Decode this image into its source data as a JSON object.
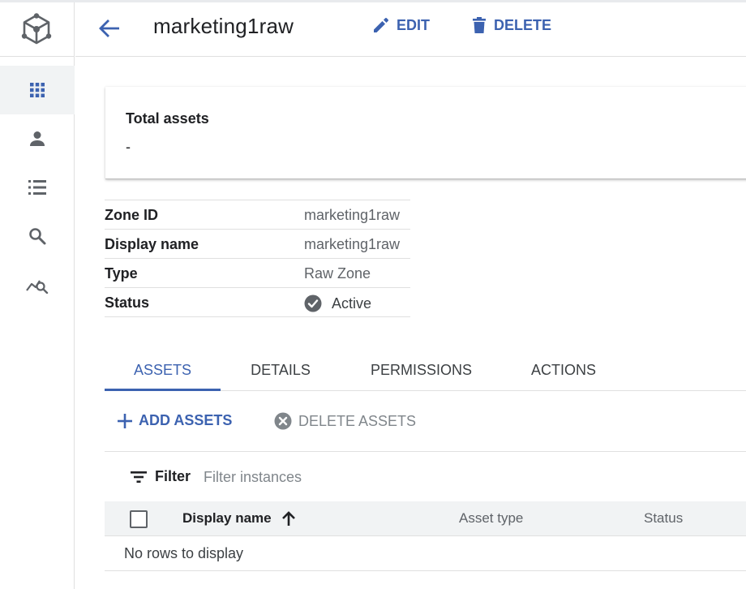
{
  "header": {
    "title": "marketing1raw",
    "edit_label": "EDIT",
    "delete_label": "DELETE"
  },
  "sidebar": {
    "items": [
      {
        "icon": "apps-grid-icon"
      },
      {
        "icon": "person-icon"
      },
      {
        "icon": "list-icon"
      },
      {
        "icon": "search-icon"
      },
      {
        "icon": "insights-search-icon"
      }
    ]
  },
  "summary": {
    "label": "Total assets",
    "value": "-"
  },
  "properties": [
    {
      "key": "Zone ID",
      "value": "marketing1raw"
    },
    {
      "key": "Display name",
      "value": "marketing1raw"
    },
    {
      "key": "Type",
      "value": "Raw Zone"
    },
    {
      "key": "Status",
      "value": "Active"
    }
  ],
  "tabs": [
    "ASSETS",
    "DETAILS",
    "PERMISSIONS",
    "ACTIONS"
  ],
  "actions": {
    "add": "ADD ASSETS",
    "delete": "DELETE ASSETS"
  },
  "filter": {
    "label": "Filter",
    "placeholder": "Filter instances"
  },
  "table": {
    "columns": [
      "Display name",
      "Asset type",
      "Status"
    ],
    "empty": "No rows to display"
  },
  "colors": {
    "accent": "#3c62b0",
    "status_ok": "#5f6368"
  }
}
